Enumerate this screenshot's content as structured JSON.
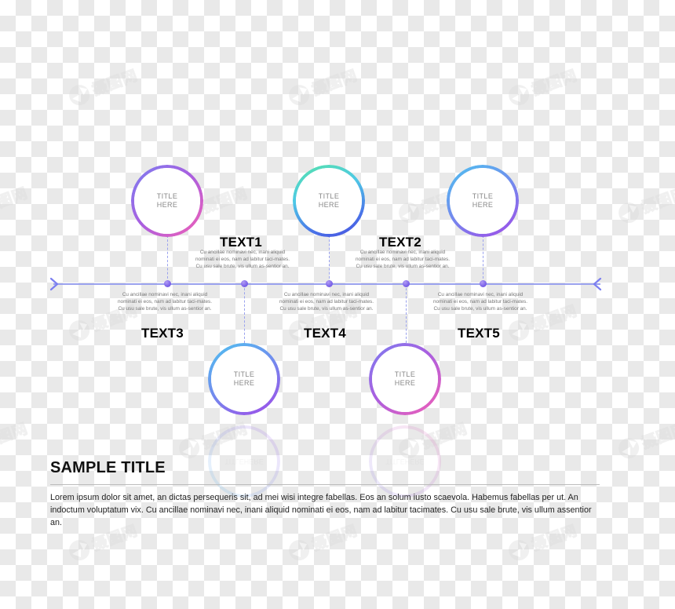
{
  "meta": {
    "watermark_text": "摄图网",
    "watermark_logo": "aperture-icon"
  },
  "circle_label": "TITLE\nHERE",
  "circle_label_line1": "TITLE",
  "circle_label_line2": "HERE",
  "body_text": "Cu ancillae nominavi nec, inani aliquid nominati ei eos, nam ad labitur taci-mates. Cu usu sale brute, vis ullum as-sentior an.",
  "timeline": {
    "left_arrow_icon": "chevron-right-icon",
    "right_arrow_icon": "chevron-left-icon",
    "line_color": "#9aa2ee",
    "dot_color": "#7c63e8"
  },
  "nodes": [
    {
      "id": "node-1",
      "heading": "TEXT1",
      "circle_title_line1": "TITLE",
      "circle_title_line2": "HERE",
      "body": "Cu ancillae nominavi nec, inani aliquid nominati ei eos, nam ad labitur taci-mates. Cu usu sale brute, vis ullum as-sentior an.",
      "position": "above",
      "gradient_from": "#7b7ef0",
      "gradient_to": "#f35fb5"
    },
    {
      "id": "node-2",
      "heading": "TEXT2",
      "circle_title_line1": "TITLE",
      "circle_title_line2": "HERE",
      "body": "Cu ancillae nominavi nec, inani aliquid nominati ei eos, nam ad labitur taci-mates. Cu usu sale brute, vis ullum as-sentior an.",
      "position": "above",
      "gradient_from": "#57e3a8",
      "gradient_to": "#4a4fe0"
    },
    {
      "id": "node-3",
      "heading": "TEXT3",
      "circle_title_line1": "TITLE",
      "circle_title_line2": "HERE",
      "body": "Cu ancillae nominavi nec, inani aliquid nominati ei eos, nam ad labitur taci-mates. Cu usu sale brute, vis ullum as-sentior an.",
      "position": "below",
      "gradient_from": "#4ec3f0",
      "gradient_to": "#a24ae8"
    },
    {
      "id": "node-4",
      "heading": "TEXT4",
      "circle_title_line1": "TITLE",
      "circle_title_line2": "HERE",
      "body": "Cu ancillae nominavi nec, inani aliquid nominati ei eos, nam ad labitur taci-mates. Cu usu sale brute, vis ullum as-sentior an.",
      "position": "below",
      "gradient_from": "#4ec3f0",
      "gradient_to": "#a24ae8"
    },
    {
      "id": "node-5",
      "heading": "TEXT5",
      "circle_title_line1": "TITLE",
      "circle_title_line2": "HERE",
      "body": "Cu ancillae nominavi nec, inani aliquid nominati ei eos, nam ad labitur taci-mates. Cu usu sale brute, vis ullum as-sentior an.",
      "position": "below",
      "gradient_from": "#7b7ef0",
      "gradient_to": "#f35fb5"
    }
  ],
  "footer": {
    "title": "SAMPLE TITLE",
    "body": "Lorem ipsum dolor sit amet, an dictas persequeris sit, ad mei wisi integre fabellas. Eos an solum iusto scaevola. Habemus fabellas per ut. An indoctum voluptatum vix. Cu ancillae nominavi nec, inani aliquid nominati ei eos, nam ad labitur tacimates. Cu usu sale brute, vis ullum assentior an."
  }
}
